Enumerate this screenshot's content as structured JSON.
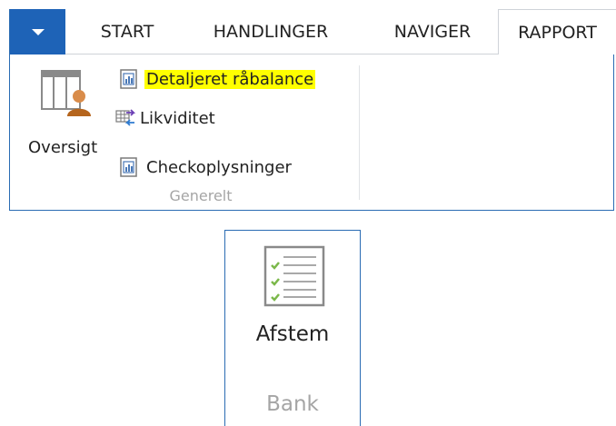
{
  "ribbon": {
    "tabs": [
      {
        "label": "START"
      },
      {
        "label": "HANDLINGER"
      },
      {
        "label": "NAVIGER"
      },
      {
        "label": "RAPPORT",
        "active": true
      }
    ],
    "groups": {
      "generelt": {
        "label": "Generelt",
        "large_button": {
          "label": "Oversigt",
          "icon": "table-person-icon"
        },
        "items": [
          {
            "label": "Detaljeret råbalance",
            "icon": "report-icon",
            "highlighted": true
          },
          {
            "label": "Likviditet",
            "icon": "liquidity-icon"
          },
          {
            "label": "Checkoplysninger",
            "icon": "report-icon"
          }
        ]
      }
    }
  },
  "bank_group": {
    "label": "Bank",
    "button": {
      "label": "Afstem",
      "icon": "checklist-icon"
    }
  },
  "colors": {
    "accent": "#1e63b7",
    "border": "#2a6cb3",
    "highlight": "#ffff00",
    "group_label": "#a5a5a5"
  }
}
